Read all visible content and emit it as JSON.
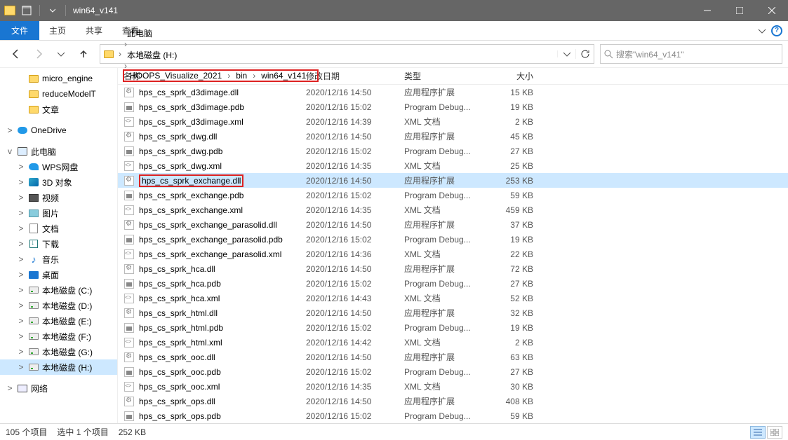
{
  "window": {
    "title": "win64_v141"
  },
  "ribbon": {
    "file": "文件",
    "tabs": [
      "主页",
      "共享",
      "查看"
    ]
  },
  "breadcrumb": {
    "items": [
      {
        "label": "此电脑",
        "highlight": false
      },
      {
        "label": "本地磁盘 (H:)",
        "highlight": false
      },
      {
        "label": "HOOPS_Visualize_2021",
        "highlight": true
      },
      {
        "label": "bin",
        "highlight": true
      },
      {
        "label": "win64_v141",
        "highlight": true
      }
    ]
  },
  "search": {
    "placeholder": "搜索\"win64_v141\""
  },
  "tree": {
    "items": [
      {
        "label": "micro_engine",
        "icon": "folder",
        "lvl": 1
      },
      {
        "label": "reduceModelT",
        "icon": "folder",
        "lvl": 1
      },
      {
        "label": "文章",
        "icon": "folder",
        "lvl": 1
      },
      {
        "spacer": true
      },
      {
        "label": "OneDrive",
        "icon": "onedrive",
        "lvl": 0,
        "exp": ">"
      },
      {
        "spacer": true
      },
      {
        "label": "此电脑",
        "icon": "pc",
        "lvl": 0,
        "exp": "v"
      },
      {
        "label": "WPS网盘",
        "icon": "wps",
        "lvl": 1,
        "exp": ">"
      },
      {
        "label": "3D 对象",
        "icon": "3d",
        "lvl": 1,
        "exp": ">"
      },
      {
        "label": "视频",
        "icon": "video",
        "lvl": 1,
        "exp": ">"
      },
      {
        "label": "图片",
        "icon": "pic",
        "lvl": 1,
        "exp": ">"
      },
      {
        "label": "文档",
        "icon": "doc",
        "lvl": 1,
        "exp": ">"
      },
      {
        "label": "下载",
        "icon": "dl",
        "lvl": 1,
        "exp": ">"
      },
      {
        "label": "音乐",
        "icon": "music",
        "lvl": 1,
        "exp": ">"
      },
      {
        "label": "桌面",
        "icon": "desktop",
        "lvl": 1,
        "exp": ">"
      },
      {
        "label": "本地磁盘 (C:)",
        "icon": "drive",
        "lvl": 1,
        "exp": ">"
      },
      {
        "label": "本地磁盘 (D:)",
        "icon": "drive",
        "lvl": 1,
        "exp": ">"
      },
      {
        "label": "本地磁盘 (E:)",
        "icon": "drive",
        "lvl": 1,
        "exp": ">"
      },
      {
        "label": "本地磁盘 (F:)",
        "icon": "drive",
        "lvl": 1,
        "exp": ">"
      },
      {
        "label": "本地磁盘 (G:)",
        "icon": "drive",
        "lvl": 1,
        "exp": ">"
      },
      {
        "label": "本地磁盘 (H:)",
        "icon": "drive",
        "lvl": 1,
        "exp": ">",
        "selected": true
      },
      {
        "spacer": true
      },
      {
        "label": "网络",
        "icon": "net",
        "lvl": 0,
        "exp": ">"
      }
    ]
  },
  "columns": {
    "name": "名称",
    "date": "修改日期",
    "type": "类型",
    "size": "大小"
  },
  "files": [
    {
      "name": "hps_cs_sprk_d3dimage.dll",
      "date": "2020/12/16 14:50",
      "type": "应用程序扩展",
      "size": "15 KB",
      "icon": "dll"
    },
    {
      "name": "hps_cs_sprk_d3dimage.pdb",
      "date": "2020/12/16 15:02",
      "type": "Program Debug...",
      "size": "19 KB",
      "icon": "pdb"
    },
    {
      "name": "hps_cs_sprk_d3dimage.xml",
      "date": "2020/12/16 14:39",
      "type": "XML 文档",
      "size": "2 KB",
      "icon": "xml"
    },
    {
      "name": "hps_cs_sprk_dwg.dll",
      "date": "2020/12/16 14:50",
      "type": "应用程序扩展",
      "size": "45 KB",
      "icon": "dll"
    },
    {
      "name": "hps_cs_sprk_dwg.pdb",
      "date": "2020/12/16 15:02",
      "type": "Program Debug...",
      "size": "27 KB",
      "icon": "pdb"
    },
    {
      "name": "hps_cs_sprk_dwg.xml",
      "date": "2020/12/16 14:35",
      "type": "XML 文档",
      "size": "25 KB",
      "icon": "xml"
    },
    {
      "name": "hps_cs_sprk_exchange.dll",
      "date": "2020/12/16 14:50",
      "type": "应用程序扩展",
      "size": "253 KB",
      "icon": "dll",
      "selected": true,
      "highlight": true
    },
    {
      "name": "hps_cs_sprk_exchange.pdb",
      "date": "2020/12/16 15:02",
      "type": "Program Debug...",
      "size": "59 KB",
      "icon": "pdb"
    },
    {
      "name": "hps_cs_sprk_exchange.xml",
      "date": "2020/12/16 14:35",
      "type": "XML 文档",
      "size": "459 KB",
      "icon": "xml"
    },
    {
      "name": "hps_cs_sprk_exchange_parasolid.dll",
      "date": "2020/12/16 14:50",
      "type": "应用程序扩展",
      "size": "37 KB",
      "icon": "dll"
    },
    {
      "name": "hps_cs_sprk_exchange_parasolid.pdb",
      "date": "2020/12/16 15:02",
      "type": "Program Debug...",
      "size": "19 KB",
      "icon": "pdb"
    },
    {
      "name": "hps_cs_sprk_exchange_parasolid.xml",
      "date": "2020/12/16 14:36",
      "type": "XML 文档",
      "size": "22 KB",
      "icon": "xml"
    },
    {
      "name": "hps_cs_sprk_hca.dll",
      "date": "2020/12/16 14:50",
      "type": "应用程序扩展",
      "size": "72 KB",
      "icon": "dll"
    },
    {
      "name": "hps_cs_sprk_hca.pdb",
      "date": "2020/12/16 15:02",
      "type": "Program Debug...",
      "size": "27 KB",
      "icon": "pdb"
    },
    {
      "name": "hps_cs_sprk_hca.xml",
      "date": "2020/12/16 14:43",
      "type": "XML 文档",
      "size": "52 KB",
      "icon": "xml"
    },
    {
      "name": "hps_cs_sprk_html.dll",
      "date": "2020/12/16 14:50",
      "type": "应用程序扩展",
      "size": "32 KB",
      "icon": "dll"
    },
    {
      "name": "hps_cs_sprk_html.pdb",
      "date": "2020/12/16 15:02",
      "type": "Program Debug...",
      "size": "19 KB",
      "icon": "pdb"
    },
    {
      "name": "hps_cs_sprk_html.xml",
      "date": "2020/12/16 14:42",
      "type": "XML 文档",
      "size": "2 KB",
      "icon": "xml"
    },
    {
      "name": "hps_cs_sprk_ooc.dll",
      "date": "2020/12/16 14:50",
      "type": "应用程序扩展",
      "size": "63 KB",
      "icon": "dll"
    },
    {
      "name": "hps_cs_sprk_ooc.pdb",
      "date": "2020/12/16 15:02",
      "type": "Program Debug...",
      "size": "27 KB",
      "icon": "pdb"
    },
    {
      "name": "hps_cs_sprk_ooc.xml",
      "date": "2020/12/16 14:35",
      "type": "XML 文档",
      "size": "30 KB",
      "icon": "xml"
    },
    {
      "name": "hps_cs_sprk_ops.dll",
      "date": "2020/12/16 14:50",
      "type": "应用程序扩展",
      "size": "408 KB",
      "icon": "dll"
    },
    {
      "name": "hps_cs_sprk_ops.pdb",
      "date": "2020/12/16 15:02",
      "type": "Program Debug...",
      "size": "59 KB",
      "icon": "pdb"
    }
  ],
  "status": {
    "count": "105 个项目",
    "selection": "选中 1 个项目",
    "size": "252 KB"
  }
}
